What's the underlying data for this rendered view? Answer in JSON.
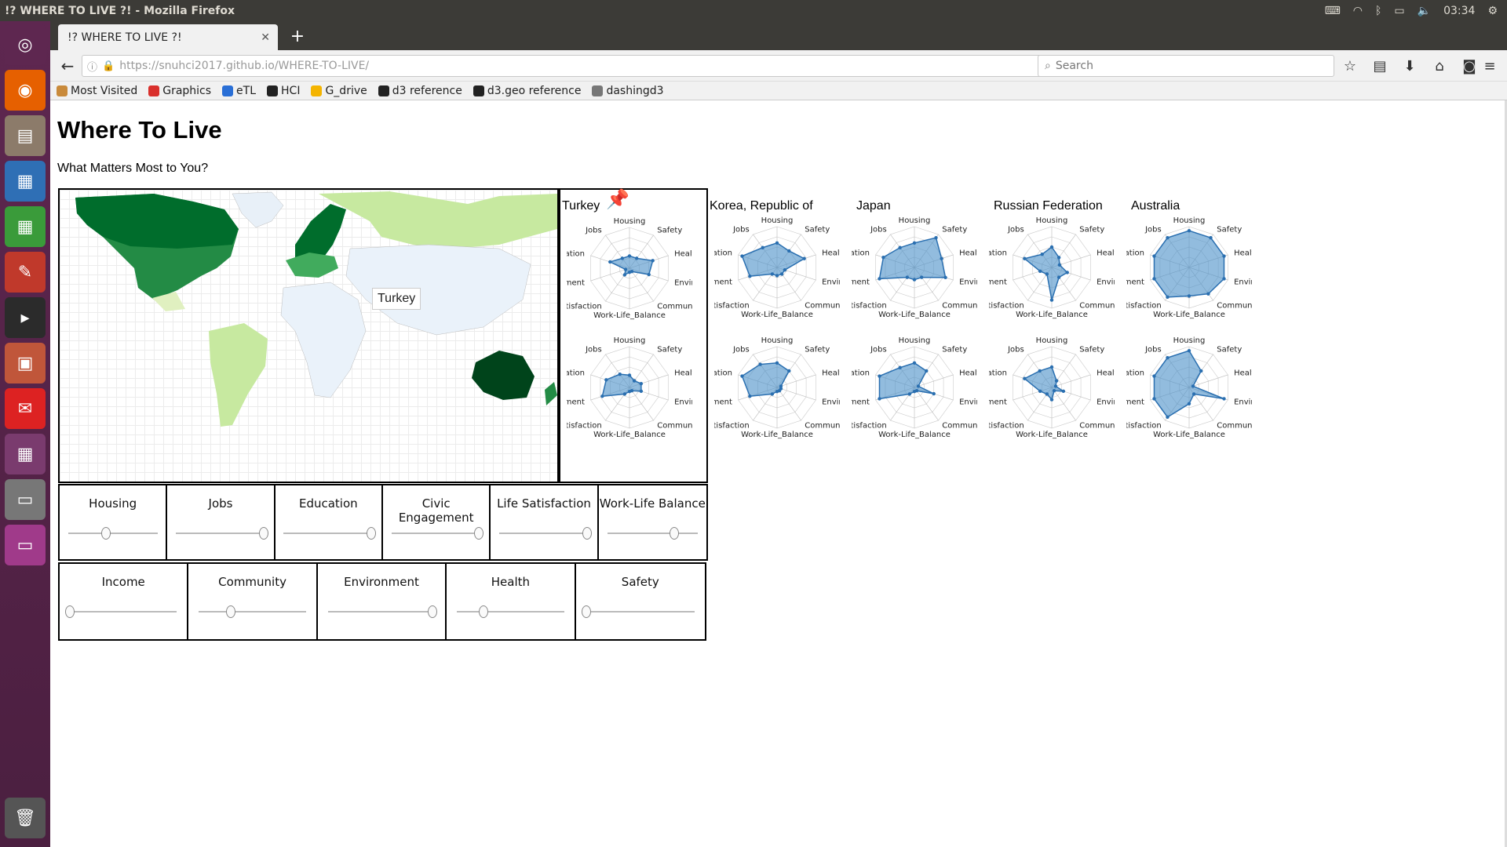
{
  "os": {
    "window_title": "!? WHERE TO LIVE ?! - Mozilla Firefox",
    "clock": "03:34"
  },
  "browser": {
    "tab_title": "!? WHERE TO LIVE ?!",
    "url_host": "https://snuhci2017.github.io",
    "url_path": "/WHERE-TO-LIVE/",
    "search_placeholder": "Search",
    "bookmarks": [
      {
        "label": "Most Visited",
        "icon": "folder-icon",
        "color": "#c98a3b"
      },
      {
        "label": "Graphics",
        "icon": "graphics-icon",
        "color": "#d9302c"
      },
      {
        "label": "eTL",
        "icon": "etl-icon",
        "color": "#2a6fd6"
      },
      {
        "label": "HCI",
        "icon": "github-icon",
        "color": "#222222"
      },
      {
        "label": "G_drive",
        "icon": "drive-icon",
        "color": "#f4b400"
      },
      {
        "label": "d3 reference",
        "icon": "github-icon",
        "color": "#222222"
      },
      {
        "label": "d3.geo reference",
        "icon": "github-icon",
        "color": "#222222"
      },
      {
        "label": "dashingd3",
        "icon": "globe-icon",
        "color": "#777777"
      }
    ]
  },
  "page": {
    "title": "Where To Live",
    "subtitle": "What Matters Most to You?",
    "tooltip": "Turkey",
    "selected_country": "Turkey",
    "axes": [
      "Housing",
      "Safety",
      "Health",
      "Environment",
      "Community",
      "Work-Life_Balance",
      "Life_Satisfaction",
      "Civic_Engagement",
      "Education",
      "Jobs"
    ],
    "countries": [
      "Korea, Republic of",
      "Japan",
      "Russian Federation",
      "Australia"
    ],
    "radar_values": {
      "Turkey": [
        [
          0.3,
          0.3,
          0.6,
          0.5,
          0.1,
          0.1,
          0.2,
          0.1,
          0.5,
          0.3
        ],
        [
          0.3,
          0.2,
          0.3,
          0.3,
          0.1,
          0.1,
          0.2,
          0.7,
          0.6,
          0.4
        ]
      ],
      "Korea, Republic of": [
        [
          0.6,
          0.5,
          0.7,
          0.2,
          0.2,
          0.2,
          0.2,
          0.7,
          0.9,
          0.6
        ],
        [
          0.6,
          0.5,
          0.1,
          0.1,
          0.1,
          0.1,
          0.2,
          0.7,
          0.9,
          0.7
        ]
      ],
      "Japan": [
        [
          0.6,
          0.9,
          0.7,
          0.8,
          0.3,
          0.3,
          0.3,
          0.9,
          0.8,
          0.6
        ],
        [
          0.6,
          0.5,
          0.1,
          0.5,
          0.1,
          0.1,
          0.2,
          0.9,
          0.9,
          0.6
        ]
      ],
      "Russian Federation": [
        [
          0.5,
          0.3,
          0.2,
          0.4,
          0.3,
          0.8,
          0.2,
          0.3,
          0.7,
          0.4
        ],
        [
          0.5,
          0.2,
          0.1,
          0.3,
          0.1,
          0.3,
          0.2,
          0.3,
          0.7,
          0.5
        ]
      ],
      "Australia": [
        [
          0.9,
          0.9,
          0.9,
          0.9,
          0.8,
          0.7,
          0.9,
          0.9,
          0.9,
          0.9
        ],
        [
          0.9,
          0.5,
          0.1,
          0.9,
          0.2,
          0.4,
          0.9,
          0.9,
          0.9,
          0.9
        ]
      ]
    },
    "sliders_row1": [
      {
        "label": "Housing",
        "value": 0.42
      },
      {
        "label": "Jobs",
        "value": 0.98
      },
      {
        "label": "Education",
        "value": 0.98
      },
      {
        "label": "Civic Engagement",
        "value": 0.98
      },
      {
        "label": "Life Satisfaction",
        "value": 0.98
      },
      {
        "label": "Work-Life Balance",
        "value": 0.74
      }
    ],
    "sliders_row2": [
      {
        "label": "Income",
        "value": 0.0
      },
      {
        "label": "Community",
        "value": 0.3
      },
      {
        "label": "Environment",
        "value": 0.98
      },
      {
        "label": "Health",
        "value": 0.25
      },
      {
        "label": "Safety",
        "value": 0.0
      }
    ]
  },
  "colors": {
    "radar_fill": "#4a90c8",
    "map_dark": "#005a32",
    "map_mid": "#238b45",
    "map_light": "#c7e9a0",
    "map_none": "#eaf2fa"
  }
}
